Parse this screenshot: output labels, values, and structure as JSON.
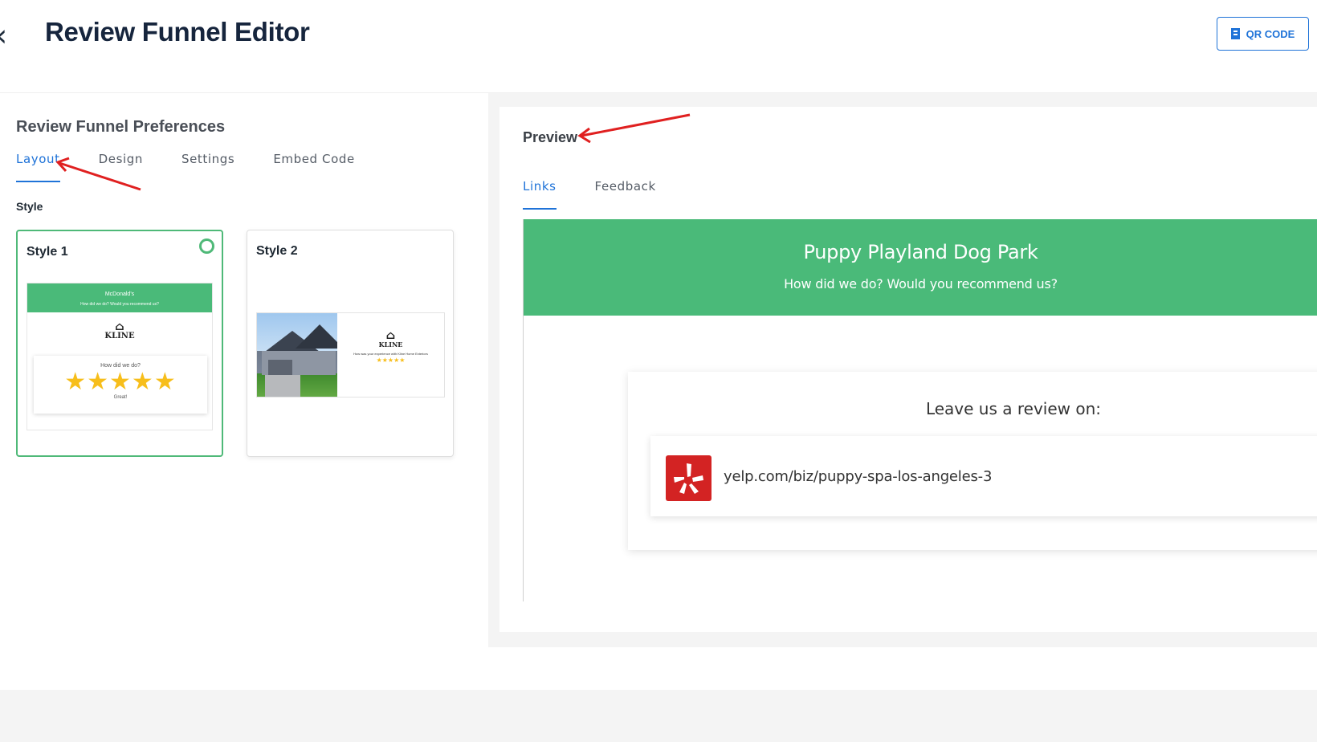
{
  "header": {
    "back_icon": "chevron-left-icon",
    "title": "Review Funnel Editor",
    "qr_button_label": "QR CODE",
    "qr_icon": "building-icon",
    "accent_color": "#1f73d8"
  },
  "preferences": {
    "title": "Review Funnel Preferences",
    "tabs": [
      {
        "label": "Layout",
        "active": true
      },
      {
        "label": "Design",
        "active": false
      },
      {
        "label": "Settings",
        "active": false
      },
      {
        "label": "Embed Code",
        "active": false
      }
    ],
    "style_label": "Style",
    "styles": [
      {
        "name": "Style 1",
        "selected": true,
        "thumb_header": "McDonald's",
        "thumb_subheader": "How did we do? Would you recommend us?",
        "thumb_logo": "KLINE",
        "thumb_question": "How did we do?",
        "thumb_stars": "★★★★★",
        "thumb_rating_label": "Great!"
      },
      {
        "name": "Style 2",
        "selected": false,
        "thumb_logo": "KLINE",
        "thumb_text": "How was your experience with Kline Home Exteriors",
        "thumb_stars": "★★★★★"
      }
    ],
    "selected_color": "#4fb978"
  },
  "preview": {
    "title": "Preview",
    "tabs": [
      {
        "label": "Links",
        "active": true
      },
      {
        "label": "Feedback",
        "active": false
      }
    ],
    "business_name": "Puppy Playland Dog Park",
    "question": "How did we do? Would you recommend us?",
    "header_color": "#4aba79",
    "leave_review_label": "Leave us a review on:",
    "links": [
      {
        "icon": "yelp-icon",
        "url": "yelp.com/biz/puppy-spa-los-angeles-3"
      }
    ]
  }
}
